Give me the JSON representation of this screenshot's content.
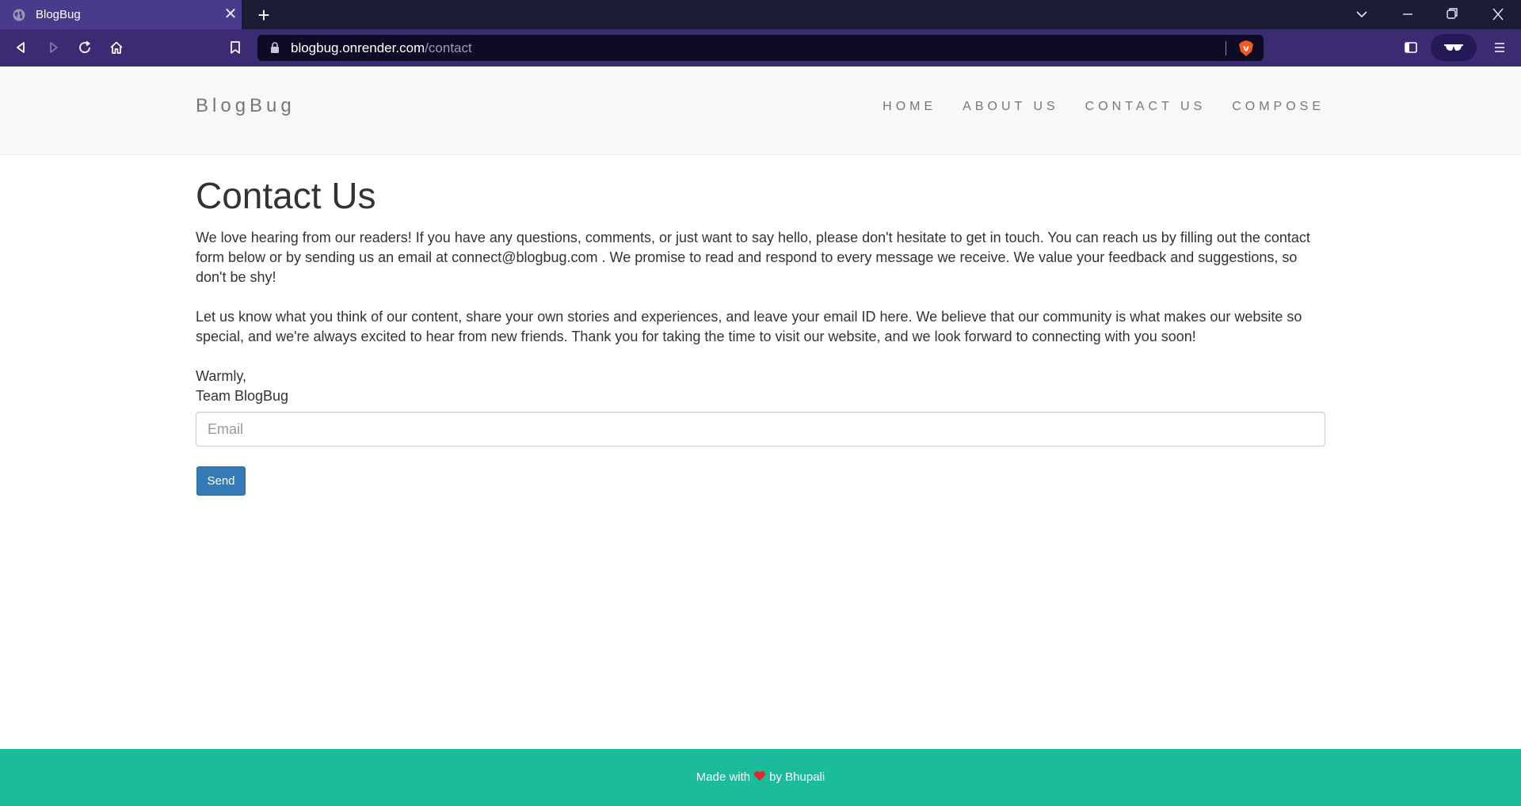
{
  "browser": {
    "tab_title": "BlogBug",
    "url_host": "blogbug.onrender.com",
    "url_path": "/contact"
  },
  "site": {
    "brand": "BlogBug",
    "nav": [
      "HOME",
      "ABOUT US",
      "CONTACT US",
      "COMPOSE"
    ]
  },
  "contact": {
    "title": "Contact Us",
    "paragraph1": "We love hearing from our readers! If you have any questions, comments, or just want to say hello, please don't hesitate to get in touch. You can reach us by filling out the contact form below or by sending us an email at connect@blogbug.com . We promise to read and respond to every message we receive. We value your feedback and suggestions, so don't be shy!",
    "paragraph2": "Let us know what you think of our content, share your own stories and experiences, and leave your email ID here. We believe that our community is what makes our website so special, and we're always excited to hear from new friends. Thank you for taking the time to visit our website, and we look forward to connecting with you soon!",
    "signoff": "Warmly,",
    "team": "Team BlogBug",
    "email_placeholder": "Email",
    "email_value": "",
    "send_label": "Send"
  },
  "footer": {
    "made_with": "Made with",
    "by": "by Bhupali"
  },
  "colors": {
    "tabbar": "#1c1b35",
    "toolbar": "#3a2b72",
    "footer": "#1abc9c",
    "button": "#337ab7"
  }
}
